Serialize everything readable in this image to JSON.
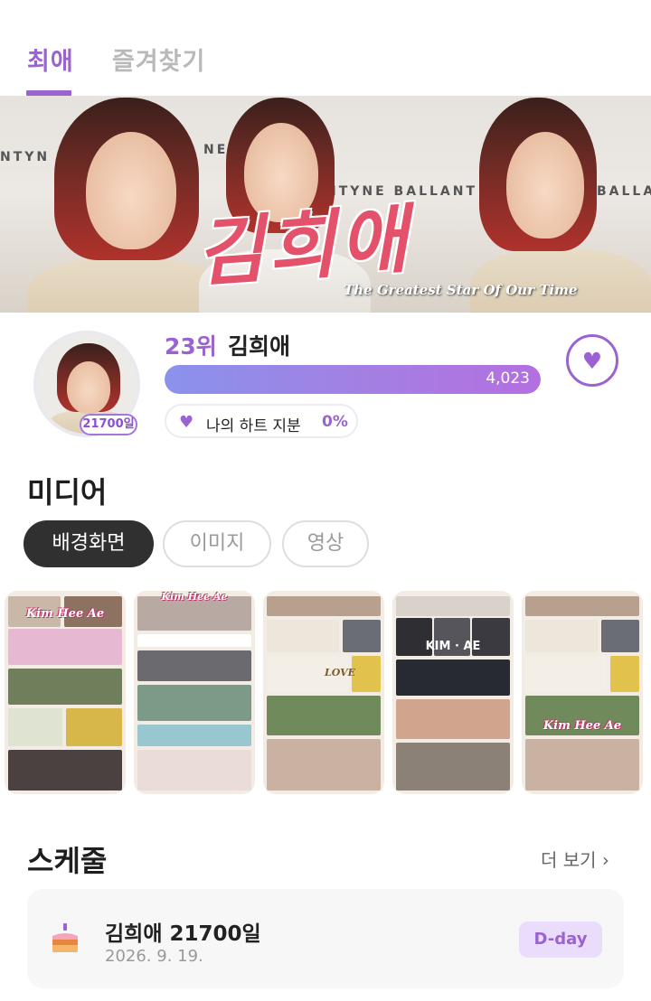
{
  "tabs": [
    {
      "label": "최애",
      "active": true
    },
    {
      "label": "즐겨찾기",
      "active": false
    }
  ],
  "banner": {
    "title": "김희애",
    "subtitle": "The Greatest Star Of Our Time",
    "backdrop_text": [
      "NTYN",
      "NE",
      "NTYNE BALLANT",
      "BALLANT"
    ]
  },
  "profile": {
    "days_badge": "21700일",
    "rank": "23위",
    "name": "김희애",
    "hearts": "4,023",
    "hearts_fill_fraction": 1.0,
    "share_label": "나의 하트 지분",
    "share_value": "0%",
    "heart_icon": "heart-icon"
  },
  "media": {
    "title": "미디어",
    "filters": [
      {
        "label": "배경화면",
        "active": true
      },
      {
        "label": "이미지",
        "active": false
      },
      {
        "label": "영상",
        "active": false
      }
    ],
    "thumbnails": [
      {
        "caption": "Kim Hee Ae"
      },
      {
        "caption": "Kim Hee Ae"
      },
      {
        "caption": "LOVE"
      },
      {
        "caption": "KIM · AE"
      },
      {
        "caption": "Kim Hee Ae"
      }
    ]
  },
  "schedule": {
    "title": "스케줄",
    "more_label": "더 보기 ›",
    "items": [
      {
        "title": "김희애 21700일",
        "date": "2026. 9. 19.",
        "badge": "D-day",
        "icon": "cake-icon"
      }
    ]
  },
  "colors": {
    "accent": "#9a63d1",
    "progress_start": "#8a92ec",
    "progress_end": "#b46fe0",
    "dday_bg": "#eadcfb"
  }
}
